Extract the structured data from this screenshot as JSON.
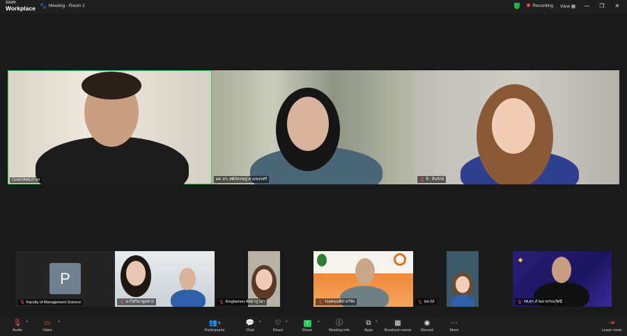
{
  "titlebar": {
    "brand_top": "zoom",
    "brand_bottom": "Workplace",
    "meeting_title": "Meeting - Room 2",
    "recording": "Recording",
    "view": "View"
  },
  "top_tiles": [
    {
      "label": "CHAIYAWUT-04",
      "muted": false
    },
    {
      "label": "ผศ. ดร. ศศิภัทรชญ์ ตามขจรศรี",
      "muted": false
    },
    {
      "label": "ปิ - สินรักษ์",
      "muted": true
    }
  ],
  "bottom_tiles": [
    {
      "label": "Faculty of Management Science",
      "muted": true,
      "avatar": "P"
    },
    {
      "label": "มาไฟวิน่าพูลซ่า2",
      "muted": true
    },
    {
      "label": "Kingkamon-ลัดดาภูวนา",
      "muted": true
    },
    {
      "label": "รองคณบดีฝ่ายวิจัย",
      "muted": true
    },
    {
      "label": "พล-03",
      "muted": true
    },
    {
      "label": "รศ.ดร.อำพล พรรณรัศมี",
      "muted": true
    }
  ],
  "toolbar": {
    "audio": "Audio",
    "video": "Video",
    "participants": "Participants",
    "participants_count": "9",
    "chat": "Chat",
    "react": "React",
    "share": "Share",
    "meeting_info": "Meeting info",
    "apps": "Apps",
    "breakout_rooms": "Breakout rooms",
    "record": "Record",
    "more": "More",
    "leave_room": "Leave room"
  }
}
